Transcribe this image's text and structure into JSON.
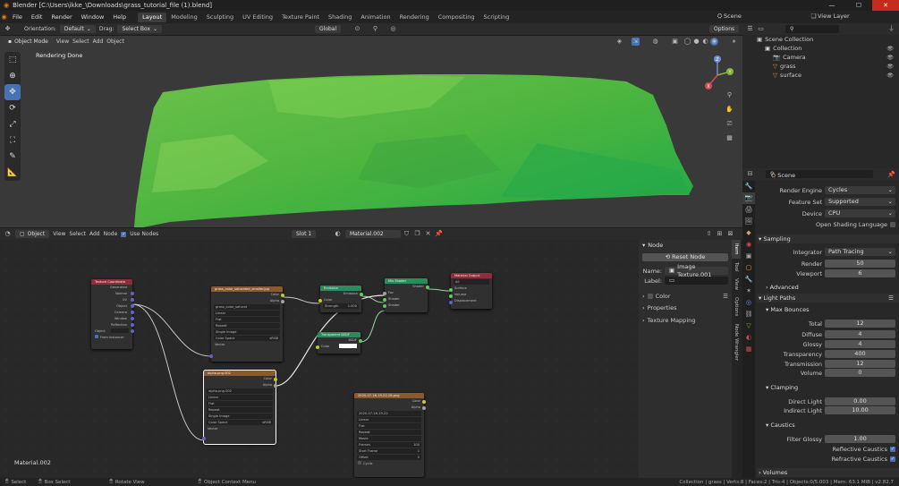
{
  "titlebar": {
    "title": "Blender [C:\\Users\\ikke_\\Downloads\\grass_tutorial_file (1).blend]",
    "min": "—",
    "max": "☐",
    "close": "✕"
  },
  "menu": {
    "items": [
      "File",
      "Edit",
      "Render",
      "Window",
      "Help"
    ],
    "workspaces": [
      "Layout",
      "Modeling",
      "Sculpting",
      "UV Editing",
      "Texture Paint",
      "Shading",
      "Animation",
      "Rendering",
      "Compositing",
      "Scripting"
    ],
    "active_workspace": "Layout",
    "scene": "Scene",
    "view_layer": "View Layer"
  },
  "viewport_header": {
    "orientation_label": "Orientation:",
    "orientation": "Default",
    "drag_label": "Drag:",
    "drag": "Select Box",
    "transform": "Global",
    "options": "Options",
    "mode": "Object Mode",
    "view": "View",
    "select": "Select",
    "add": "Add",
    "object": "Object"
  },
  "viewport": {
    "status": "Rendering Done",
    "gizmo": {
      "z": "Z",
      "y": "Y",
      "x": "X"
    }
  },
  "node_header": {
    "editor": "Object",
    "view": "View",
    "select": "Select",
    "add": "Add",
    "node": "Node",
    "use_nodes": "Use Nodes",
    "slot": "Slot 1",
    "material": "Material.002"
  },
  "node_editor": {
    "material_label": "Material.002"
  },
  "nodes": {
    "texcoord": {
      "title": "Texture Coordinate",
      "outputs": [
        "Generated",
        "Normal",
        "UV",
        "Object",
        "Camera",
        "Window",
        "Reflection"
      ],
      "object": "Object",
      "from_instancer": "From Instancer"
    },
    "img1": {
      "title": "grass_color_saturated_smaller.jpg",
      "outputs": [
        "Color",
        "Alpha"
      ],
      "file": "grass_color_saturat",
      "fields": [
        "Linear",
        "Flat",
        "Repeat",
        "Single Image"
      ],
      "cs_label": "Color Space",
      "cs": "sRGB",
      "vector": "Vector"
    },
    "emission": {
      "title": "Emission",
      "out": "Emission",
      "color": "Color",
      "strength_label": "Strength",
      "strength": "1.000"
    },
    "mix": {
      "title": "Mix Shader",
      "out": "Shader",
      "fac": "Fac",
      "shader1": "Shader",
      "shader2": "Shader"
    },
    "output": {
      "title": "Material Output",
      "target": "All",
      "surface": "Surface",
      "volume": "Volume",
      "displacement": "Displacement"
    },
    "transparent": {
      "title": "Transparent BSDF",
      "out": "BSDF",
      "color": "Color"
    },
    "alpha": {
      "title": "alpha.png.002",
      "outputs": [
        "Color",
        "Alpha"
      ],
      "file": "alpha.png.002",
      "fields": [
        "Linear",
        "Flat",
        "Repeat",
        "Single Image"
      ],
      "cs_label": "Color Space",
      "cs": "sRGB",
      "vector": "Vector"
    },
    "img3": {
      "title": "2020-07-16-19-22-28.png",
      "outputs": [
        "Color",
        "Alpha"
      ],
      "file": "2020-07-16-19-22",
      "fields": [
        "Linear",
        "Flat",
        "Repeat",
        "Movie"
      ],
      "frames_label": "Frames",
      "frames": "100",
      "start_label": "Start Frame",
      "start": "1",
      "offset_label": "Offset",
      "offset": "0",
      "cyclic": "Cyclic"
    }
  },
  "node_sidebar": {
    "section": "Node",
    "reset": "Reset Node",
    "name_label": "Name:",
    "name": "Image Texture.001",
    "label_label": "Label:",
    "color": "Color",
    "properties": "Properties",
    "texture_mapping": "Texture Mapping",
    "tabs": [
      "Item",
      "Tool",
      "View",
      "Options",
      "Node Wrangler"
    ]
  },
  "outliner": {
    "root": "Scene Collection",
    "items": [
      {
        "label": "Collection",
        "depth": 1,
        "icon": "▣"
      },
      {
        "label": "Camera",
        "depth": 2,
        "icon": "📷"
      },
      {
        "label": "grass",
        "depth": 2,
        "icon": "▽"
      },
      {
        "label": "surface",
        "depth": 2,
        "icon": "▽"
      }
    ]
  },
  "properties": {
    "title": "Scene",
    "render_engine_label": "Render Engine",
    "render_engine": "Cycles",
    "feature_set_label": "Feature Set",
    "feature_set": "Supported",
    "device_label": "Device",
    "device": "CPU",
    "osl": "Open Shading Language",
    "sampling": "Sampling",
    "integrator_label": "Integrator",
    "integrator": "Path Tracing",
    "render_label": "Render",
    "render": "50",
    "viewport_label": "Viewport",
    "viewport": "6",
    "advanced": "Advanced",
    "light_paths": "Light Paths",
    "max_bounces": "Max Bounces",
    "total_label": "Total",
    "total": "12",
    "diffuse_label": "Diffuse",
    "diffuse": "4",
    "glossy_label": "Glossy",
    "glossy": "4",
    "transparency_label": "Transparency",
    "transparency": "400",
    "transmission_label": "Transmission",
    "transmission": "12",
    "volume_label": "Volume",
    "volume": "0",
    "clamping": "Clamping",
    "direct_label": "Direct Light",
    "direct": "0.00",
    "indirect_label": "Indirect Light",
    "indirect": "10.00",
    "caustics": "Caustics",
    "filter_label": "Filter Glossy",
    "filter": "1.00",
    "refl_caustics": "Reflective Caustics",
    "refr_caustics": "Refractive Caustics",
    "volumes": "Volumes"
  },
  "status": {
    "select": "Select",
    "box_select": "Box Select",
    "rotate": "Rotate View",
    "context": "Object Context Menu",
    "info": "Collection | grass | Verts:8 | Faces:2 | Tris:4 | Objects:0/5.003 | Mem: 63.1 MiB | v2.82.7"
  }
}
